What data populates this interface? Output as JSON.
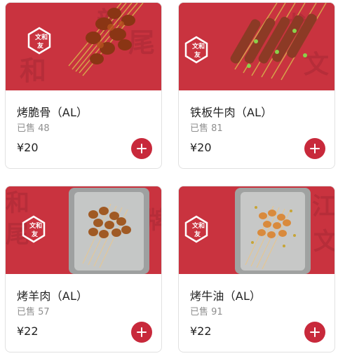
{
  "brand": {
    "logo_text": "文和友"
  },
  "products": [
    {
      "name": "烤脆骨（AL）",
      "sold": "已售 48",
      "price": "¥20"
    },
    {
      "name": "铁板牛肉（AL）",
      "sold": "已售 81",
      "price": "¥20"
    },
    {
      "name": "烤羊肉（AL）",
      "sold": "已售 57",
      "price": "¥22"
    },
    {
      "name": "烤牛油（AL）",
      "sold": "已售 91",
      "price": "¥22"
    }
  ],
  "colors": {
    "banner": "#c9333f",
    "accent": "#c8293b"
  },
  "icons": {
    "add": "plus-circle-icon"
  }
}
